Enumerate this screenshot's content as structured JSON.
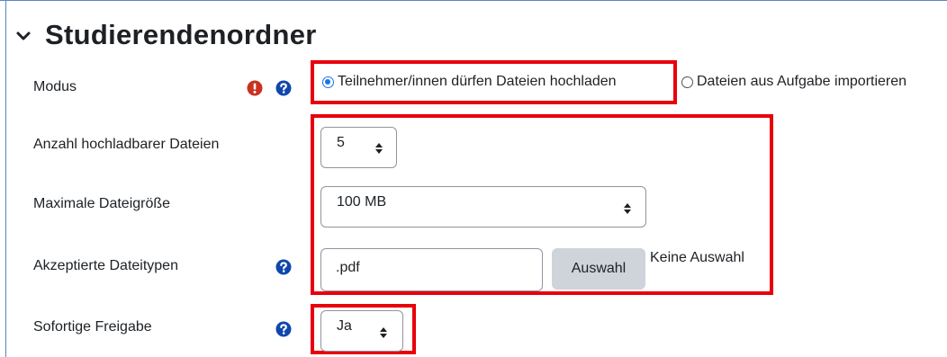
{
  "section": {
    "title": "Studierendenordner"
  },
  "fields": {
    "mode": {
      "label": "Modus",
      "option_upload": "Teilnehmer/innen dürfen Dateien hochladen",
      "option_import": "Dateien aus Aufgabe importieren",
      "selected": "option_upload"
    },
    "max_files": {
      "label": "Anzahl hochladbarer Dateien",
      "value": "5"
    },
    "max_size": {
      "label": "Maximale Dateigröße",
      "value": "100 MB"
    },
    "file_types": {
      "label": "Akzeptierte Dateitypen",
      "value": ".pdf",
      "button": "Auswahl",
      "status": "Keine Auswahl"
    },
    "release": {
      "label": "Sofortige Freigabe",
      "value": "Ja"
    }
  },
  "colors": {
    "highlight": "#e8000b",
    "help_icon": "#0f47ad",
    "error_icon": "#ca3120",
    "radio": "#1a73e8"
  },
  "icons": {
    "help": "question-circle-icon",
    "error": "exclamation-circle-icon",
    "collapse": "chevron-down-icon",
    "select": "sort-arrows-icon"
  }
}
